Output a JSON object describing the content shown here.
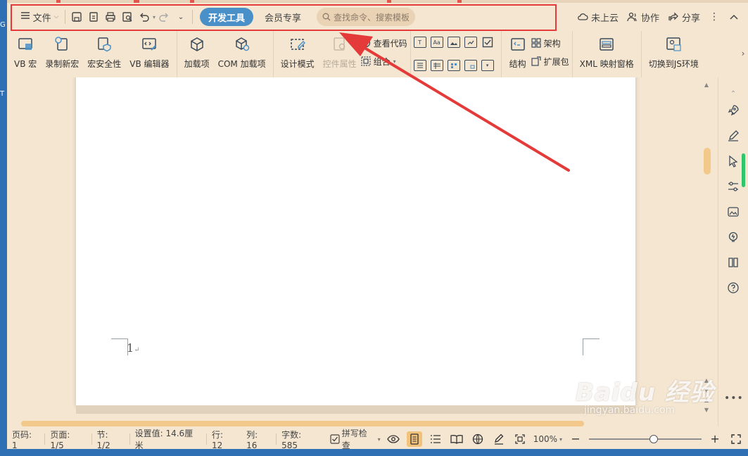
{
  "desktop": {
    "left_glyphs": [
      "G",
      "T"
    ]
  },
  "quick_bar": {
    "file_menu": "文件",
    "tabs": [
      {
        "label": "开发工具",
        "active": true
      },
      {
        "label": "会员专享",
        "active": false
      }
    ],
    "search_placeholder": "查找命令、搜索模板",
    "right": {
      "cloud": "未上云",
      "collab": "协作",
      "share": "分享"
    }
  },
  "ribbon": {
    "macro_group": [
      "VB 宏",
      "录制新宏",
      "宏安全性",
      "VB 编辑器"
    ],
    "addin_group": [
      "加载项",
      "COM 加载项"
    ],
    "controls_group": {
      "design_mode": "设计模式",
      "control_props": "控件属性",
      "view_code": "查看代码",
      "combine": "组合"
    },
    "form_icons": [
      "T",
      "Aa",
      "img",
      "pic",
      "chk",
      "lst",
      "tbl",
      "ab",
      "frm",
      "dd"
    ],
    "structure_group": {
      "structure": "结构",
      "architecture": "架构",
      "expansion": "扩展包"
    },
    "xml_pane": "XML 映射窗格",
    "switch_js": "切换到JS环境"
  },
  "document": {
    "page_number": "1",
    "para_mark": "↵"
  },
  "status_bar": {
    "page_code": "页码: 1",
    "page": "页面: 1/5",
    "section": "节: 1/2",
    "setting": "设置值: 14.6厘米",
    "line": "行: 12",
    "column": "列: 16",
    "word_count": "字数: 585",
    "spell_check": "拼写检查",
    "zoom": "100%"
  },
  "watermark": {
    "main": "Baidu 经验",
    "sub": "jingyan.baidu.com"
  },
  "colors": {
    "background": "#f4e6d1",
    "accent": "#4a90c8",
    "highlight_red": "#e53a3a",
    "scroll_thumb": "#f2c98a"
  }
}
